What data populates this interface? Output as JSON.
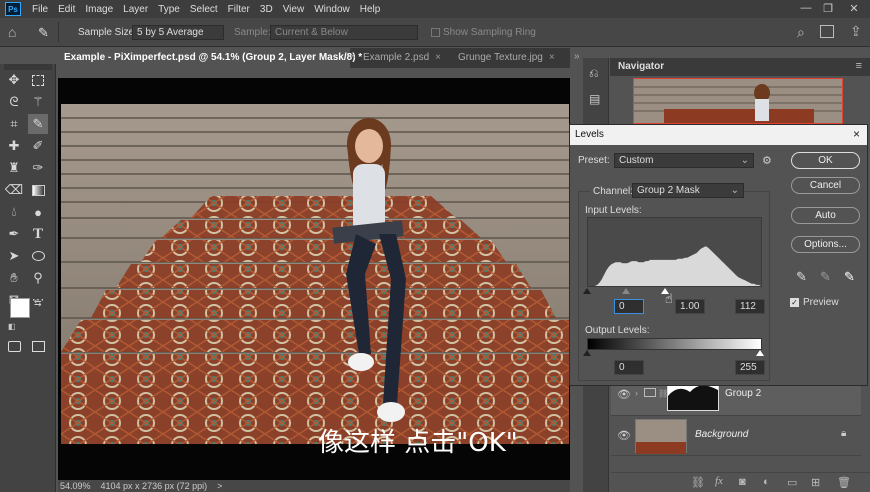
{
  "app": {
    "logo": "Ps",
    "menu": [
      "File",
      "Edit",
      "Image",
      "Layer",
      "Type",
      "Select",
      "Filter",
      "3D",
      "View",
      "Window",
      "Help"
    ]
  },
  "options": {
    "sample_size_label": "Sample Size:",
    "sample_size_value": "5 by 5 Average",
    "sample_label": "Sample:",
    "sample_value": "Current & Below",
    "show_ring_label": "Show Sampling Ring"
  },
  "tabs": [
    {
      "label": "Example - PiXimperfect.psd @ 54.1% (Group 2, Layer Mask/8) *",
      "close": "×"
    },
    {
      "label": "Example 2.psd",
      "close": "×"
    },
    {
      "label": "Grunge Texture.jpg",
      "close": "×"
    }
  ],
  "tab_more": "»",
  "canvas": {
    "subtitle": "像这样 点击\"OK\""
  },
  "status": {
    "zoom": "54.09%",
    "doc_info": "4104 px x 2736 px (72 ppi)",
    "arrow": ">"
  },
  "navigator": {
    "title": "Navigator"
  },
  "layers": [
    {
      "name": "Group 2"
    },
    {
      "name": "Background"
    }
  ],
  "levels": {
    "title": "Levels",
    "close": "×",
    "preset_label": "Preset:",
    "preset_value": "Custom",
    "channel_label": "Channel:",
    "channel_value": "Group 2 Mask",
    "input_label": "Input Levels:",
    "input_black": "0",
    "input_gamma": "1.00",
    "input_white": "112",
    "output_label": "Output Levels:",
    "output_black": "0",
    "output_white": "255",
    "ok": "OK",
    "cancel": "Cancel",
    "auto": "Auto",
    "options": "Options...",
    "preview": "Preview",
    "preview_checked": true,
    "histogram": [
      0,
      0,
      0,
      0,
      1,
      3,
      6,
      10,
      14,
      17,
      19,
      20,
      21,
      21,
      21,
      20,
      20,
      20,
      21,
      22,
      22,
      22,
      21,
      21,
      21,
      22,
      22,
      23,
      23,
      23,
      23,
      23,
      23,
      23,
      23,
      23,
      23,
      23,
      23,
      24,
      24,
      24,
      25,
      25,
      26,
      27,
      28,
      29,
      31,
      33,
      34,
      35,
      34,
      32,
      30,
      28,
      26,
      24,
      22,
      20,
      18,
      16,
      14,
      12,
      10,
      8,
      7,
      6,
      5,
      4,
      3,
      2,
      2,
      1,
      1,
      0
    ]
  },
  "colors": {
    "accent": "#31a8ff",
    "dialog_bg": "#535353",
    "panel_dark": "#3a3a3a"
  }
}
